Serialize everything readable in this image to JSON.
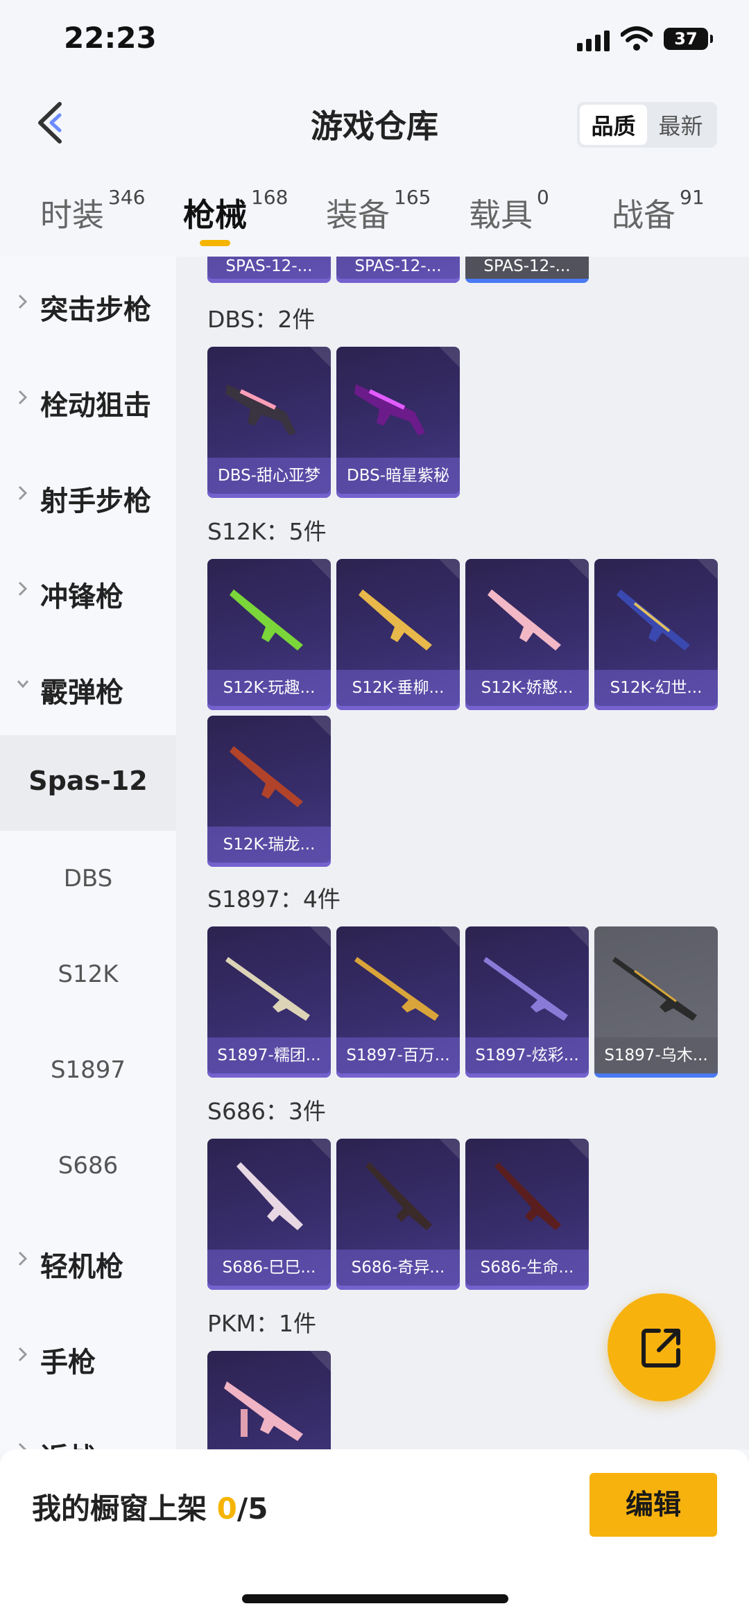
{
  "status_bar": {
    "time": "22:23",
    "battery": "37"
  },
  "header": {
    "title": "游戏仓库",
    "sort_options": [
      "品质",
      "最新"
    ],
    "active_sort": "品质"
  },
  "tabs": [
    {
      "label": "时装",
      "count": "346"
    },
    {
      "label": "枪械",
      "count": "168"
    },
    {
      "label": "装备",
      "count": "165"
    },
    {
      "label": "载具",
      "count": "0"
    },
    {
      "label": "战备",
      "count": "91"
    }
  ],
  "active_tab": "枪械",
  "sidebar": {
    "categories": [
      "突击步枪",
      "栓动狙击",
      "射手步枪",
      "冲锋枪",
      "霰弹枪"
    ],
    "expanded": "霰弹枪",
    "selected": "Spas-12",
    "subitems": [
      "DBS",
      "S12K",
      "S1897",
      "S686"
    ],
    "more_categories": [
      "轻机枪",
      "手枪",
      "近战"
    ]
  },
  "content": {
    "top_partial": [
      "SPAS-12-...",
      "SPAS-12-...",
      "SPAS-12-..."
    ],
    "sections": [
      {
        "title": "DBS：2件",
        "items": [
          "DBS-甜心亚梦",
          "DBS-暗星紫秘"
        ]
      },
      {
        "title": "S12K：5件",
        "items": [
          "S12K-玩趣...",
          "S12K-垂柳...",
          "S12K-娇憨...",
          "S12K-幻世...",
          "S12K-瑞龙..."
        ]
      },
      {
        "title": "S1897：4件",
        "items": [
          "S1897-糯团...",
          "S1897-百万...",
          "S1897-炫彩...",
          "S1897-乌木..."
        ]
      },
      {
        "title": "S686：3件",
        "items": [
          "S686-巳巳...",
          "S686-奇异...",
          "S686-生命..."
        ]
      },
      {
        "title": "PKM：1件",
        "items": []
      }
    ]
  },
  "bottom": {
    "shelf_label": "我的橱窗上架",
    "shelf_count": "0",
    "shelf_total": "/5",
    "edit_label": "编辑"
  },
  "colors": {
    "accent": "#f7b20e",
    "card_bg": "#372d6b",
    "card_caption": "#6e5cc8"
  }
}
